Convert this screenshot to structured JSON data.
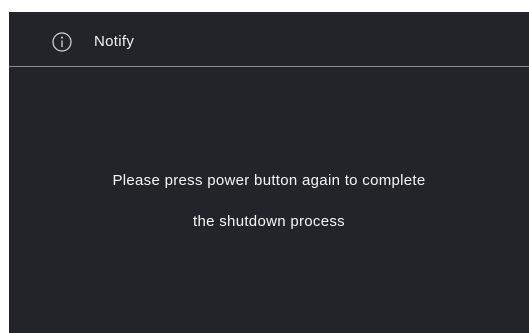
{
  "dialog": {
    "title": "Notify",
    "icon": "info-icon",
    "message_line1": "Please press power button again to complete",
    "message_line2": "the shutdown process"
  },
  "colors": {
    "background": "#23242a",
    "text": "#ffffff",
    "divider": "#8a8b8f"
  }
}
